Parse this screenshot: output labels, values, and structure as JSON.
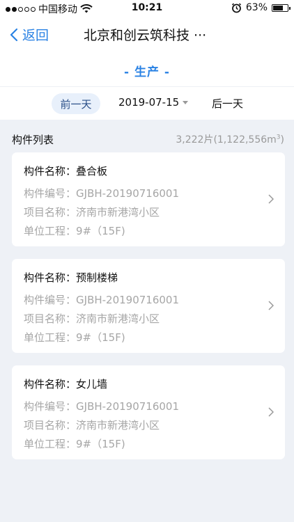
{
  "status_bar": {
    "carrier": "中国移动",
    "time": "10:21",
    "battery_percent": "63%"
  },
  "nav": {
    "back_label": "返回",
    "title": "北京和创云筑科技 ···"
  },
  "section": {
    "label": "- 生产 -"
  },
  "date_bar": {
    "prev_label": "前一天",
    "date": "2019-07-15",
    "next_label": "后一天"
  },
  "list": {
    "title": "构件列表",
    "count_prefix": "3,222片(1,122,556m",
    "count_sup": "3",
    "count_suffix": ")",
    "items": [
      {
        "name_label": "构件名称：",
        "name": "叠合板",
        "code_label": "构件编号：",
        "code": "GJBH-20190716001",
        "project_label": "项目名称：",
        "project": "济南市新港湾小区",
        "unit_label": "单位工程：",
        "unit": "9#（15F)"
      },
      {
        "name_label": "构件名称：",
        "name": "预制楼梯",
        "code_label": "构件编号：",
        "code": "GJBH-20190716001",
        "project_label": "项目名称：",
        "project": "济南市新港湾小区",
        "unit_label": "单位工程：",
        "unit": "9#（15F)"
      },
      {
        "name_label": "构件名称：",
        "name": "女儿墙",
        "code_label": "构件编号：",
        "code": "GJBH-20190716001",
        "project_label": "项目名称：",
        "project": "济南市新港湾小区",
        "unit_label": "单位工程：",
        "unit": "9#（15F)"
      }
    ]
  },
  "colors": {
    "accent": "#2a82e4",
    "background": "#eef1f6",
    "muted_text": "#a6a6a6"
  },
  "icons": [
    "signal-dots-icon",
    "wifi-icon",
    "alarm-icon",
    "battery-icon",
    "back-chevron-icon",
    "dropdown-caret-icon",
    "chevron-right-icon"
  ]
}
